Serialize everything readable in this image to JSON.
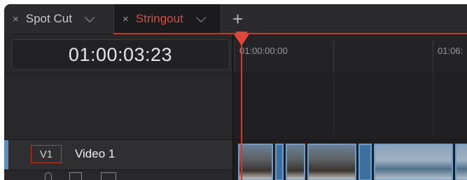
{
  "tabs": [
    {
      "label": "Spot Cut",
      "close": "×",
      "active": false
    },
    {
      "label": "Stringout",
      "close": "×",
      "active": true
    }
  ],
  "add_tab_glyph": "+",
  "timecode": "01:00:03:23",
  "ruler_labels": [
    "01:00:00:00",
    "01:06:"
  ],
  "track": {
    "id": "V1",
    "name": "Video 1"
  },
  "colors": {
    "accent": "#e0493c",
    "playhead": "#d13b2e",
    "clip_border": "#6a9ccc",
    "track_marker": "#5b8dbf"
  },
  "icons": [
    "close-icon",
    "chevron-down-icon",
    "plus-icon",
    "lock-icon",
    "auto-track-icon",
    "film-icon"
  ]
}
